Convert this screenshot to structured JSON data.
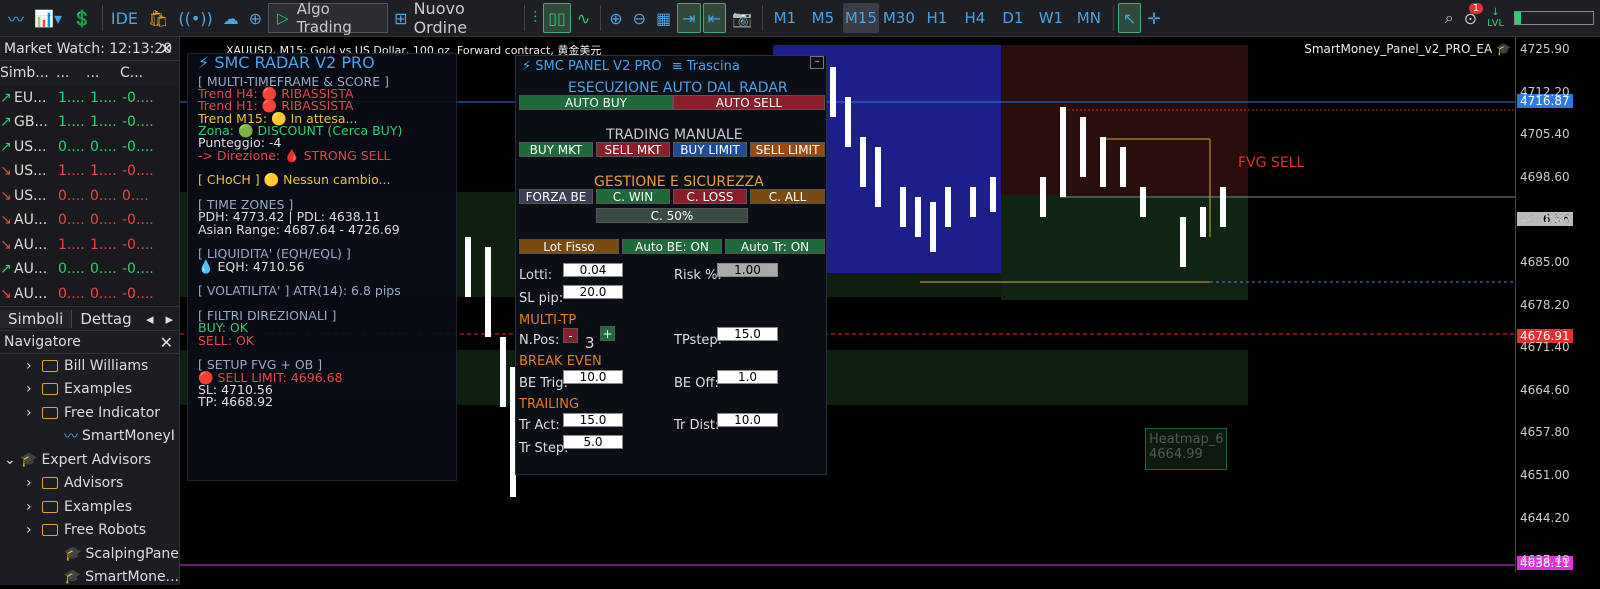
{
  "toolbar": {
    "algo": "Algo Trading",
    "nuovo": "Nuovo Ordine",
    "ide": "IDE",
    "timeframes": [
      "M1",
      "M5",
      "M15",
      "M30",
      "H1",
      "H4",
      "D1",
      "W1",
      "MN"
    ],
    "active_tf": "M15",
    "notif": "1",
    "lvl": "LVL"
  },
  "market_watch": {
    "title": "Market Watch: 12:13:20",
    "cols": [
      "Simb...",
      "...",
      "...",
      "C..."
    ],
    "rows": [
      {
        "s": "EU...",
        "b": "1....",
        "a": "1....",
        "c": "-0....",
        "d": "up"
      },
      {
        "s": "GB...",
        "b": "1....",
        "a": "1....",
        "c": "-0....",
        "d": "up"
      },
      {
        "s": "US...",
        "b": "0....",
        "a": "0....",
        "c": "-0....",
        "d": "up"
      },
      {
        "s": "US...",
        "b": "1....",
        "a": "1....",
        "c": "-0....",
        "d": "dn"
      },
      {
        "s": "US...",
        "b": "0....",
        "a": "0....",
        "c": "0....",
        "d": "dn"
      },
      {
        "s": "AU...",
        "b": "0....",
        "a": "0....",
        "c": "-0....",
        "d": "dn"
      },
      {
        "s": "AU...",
        "b": "1....",
        "a": "1....",
        "c": "-0....",
        "d": "dn"
      },
      {
        "s": "AU...",
        "b": "0....",
        "a": "0....",
        "c": "-0....",
        "d": "up"
      },
      {
        "s": "AU...",
        "b": "0....",
        "a": "0....",
        "c": "-0....",
        "d": "dn"
      }
    ],
    "tabs": [
      "Simboli",
      "Dettag"
    ]
  },
  "navigator": {
    "title": "Navigatore",
    "items": [
      {
        "l": "Bill Williams",
        "t": "f",
        "i": 1
      },
      {
        "l": "Examples",
        "t": "f",
        "i": 1
      },
      {
        "l": "Free Indicator",
        "t": "f",
        "i": 1
      },
      {
        "l": "SmartMoneyI",
        "t": "i",
        "i": 2
      },
      {
        "l": "Expert Advisors",
        "t": "e",
        "i": 0
      },
      {
        "l": "Advisors",
        "t": "f",
        "i": 1
      },
      {
        "l": "Examples",
        "t": "f",
        "i": 1
      },
      {
        "l": "Free Robots",
        "t": "f",
        "i": 1
      },
      {
        "l": "ScalpingPane",
        "t": "e",
        "i": 2
      },
      {
        "l": "SmartMone...",
        "t": "e",
        "i": 2
      }
    ]
  },
  "chart": {
    "header": "XAUUSD, M15:  Gold vs US Dollar, 100 oz. Forward contract, 黄金美元",
    "ea": "SmartMoney_Panel_v2_PRO_EA",
    "fvg": "FVG SELL",
    "heatmap": "Heatmap_6",
    "heatmap_val": "4664.99"
  },
  "axis": {
    "labels": [
      "4725.90",
      "4712.20",
      "4705.40",
      "4698.60",
      "4691.80",
      "4685.00",
      "4678.20",
      "4671.40",
      "4664.60",
      "4657.80",
      "4651.00",
      "4644.20",
      "4637.40"
    ],
    "bid": "4716.87",
    "ask": "4696.56",
    "red": "4676.91",
    "mag": "4638.11"
  },
  "radar": {
    "title": "SMC RADAR V2 PRO",
    "lines": [
      {
        "t": "[ MULTI-TIMEFRAME & SCORE ]",
        "c": "#9aa7c8"
      },
      {
        "t": "Trend H4:  🔴  RIBASSISTA",
        "c": "#e04848"
      },
      {
        "t": "Trend H1:  🔴  RIBASSISTA",
        "c": "#e04848"
      },
      {
        "t": "Trend M15:  🟡  In attesa...",
        "c": "#e8c040"
      },
      {
        "t": "Zona:  🟢  DISCOUNT (Cerca BUY)",
        "c": "#2bd070"
      },
      {
        "t": "Punteggio: -4",
        "c": "#ddd"
      },
      {
        "t": "-> Direzione:  🩸  STRONG SELL",
        "c": "#e04848"
      },
      {
        "t": "",
        "c": "#ddd"
      },
      {
        "t": "[ CHoCH ]  🟡  Nessun cambio...",
        "c": "#e8c040"
      },
      {
        "t": "",
        "c": "#ddd"
      },
      {
        "t": "[ TIME ZONES ]",
        "c": "#9aa7c8"
      },
      {
        "t": "PDH: 4773.42 | PDL: 4638.11",
        "c": "#ddd"
      },
      {
        "t": "Asian Range: 4687.64 - 4726.69",
        "c": "#ddd"
      },
      {
        "t": "",
        "c": "#ddd"
      },
      {
        "t": "[ LIQUIDITA' (EQH/EQL) ]",
        "c": "#9aa7c8"
      },
      {
        "t": "💧  EQH: 4710.56",
        "c": "#ddd"
      },
      {
        "t": "",
        "c": "#ddd"
      },
      {
        "t": "[ VOLATILITA' ] ATR(14): 6.8 pips",
        "c": "#9aa7c8"
      },
      {
        "t": "",
        "c": "#ddd"
      },
      {
        "t": "[ FILTRI DIREZIONALI ]",
        "c": "#9aa7c8"
      },
      {
        "t": "BUY: OK",
        "c": "#2bd070"
      },
      {
        "t": "SELL: OK",
        "c": "#e04848"
      },
      {
        "t": "",
        "c": "#ddd"
      },
      {
        "t": "[ SETUP FVG + OB ]",
        "c": "#9aa7c8"
      },
      {
        "t": "🔴  SELL LIMIT: 4696.68",
        "c": "#e04848"
      },
      {
        "t": "SL: 4710.56",
        "c": "#ddd"
      },
      {
        "t": "TP: 4668.92",
        "c": "#ddd"
      }
    ]
  },
  "panel": {
    "title": "SMC PANEL V2 PRO",
    "drag": "≡ Trascina",
    "sec_auto": "ESECUZIONE AUTO DAL RADAR",
    "auto_buy": "AUTO BUY",
    "auto_sell": "AUTO SELL",
    "sec_man": "TRADING MANUALE",
    "buy_mkt": "BUY MKT",
    "sell_mkt": "SELL MKT",
    "buy_limit": "BUY LIMIT",
    "sell_limit": "SELL LIMIT",
    "sec_ges": "GESTIONE E SICUREZZA",
    "forza_be": "FORZA BE",
    "c_win": "C. WIN",
    "c_loss": "C. LOSS",
    "c_all": "C. ALL",
    "c50": "C. 50%",
    "lot_fisso": "Lot Fisso",
    "auto_be": "Auto BE: ON",
    "auto_tr": "Auto Tr: ON",
    "lotti_l": "Lotti:",
    "lotti": "0.04",
    "risk_l": "Risk %:",
    "risk": "1.00",
    "sl_l": "SL pip:",
    "sl": "20.0",
    "multi": "MULTI-TP",
    "npos_l": "N.Pos:",
    "npos": "3",
    "minus": "-",
    "plus": "+",
    "tpstep_l": "TPstep:",
    "tpstep": "15.0",
    "be": "BREAK EVEN",
    "betrig_l": "BE Trig:",
    "betrig": "10.0",
    "beoff_l": "BE Off:",
    "beoff": "1.0",
    "trailing": "TRAILING",
    "tract_l": "Tr Act:",
    "tract": "15.0",
    "trdist_l": "Tr Dist:",
    "trdist": "10.0",
    "trstep_l": "Tr Step:",
    "trstep": "5.0"
  }
}
